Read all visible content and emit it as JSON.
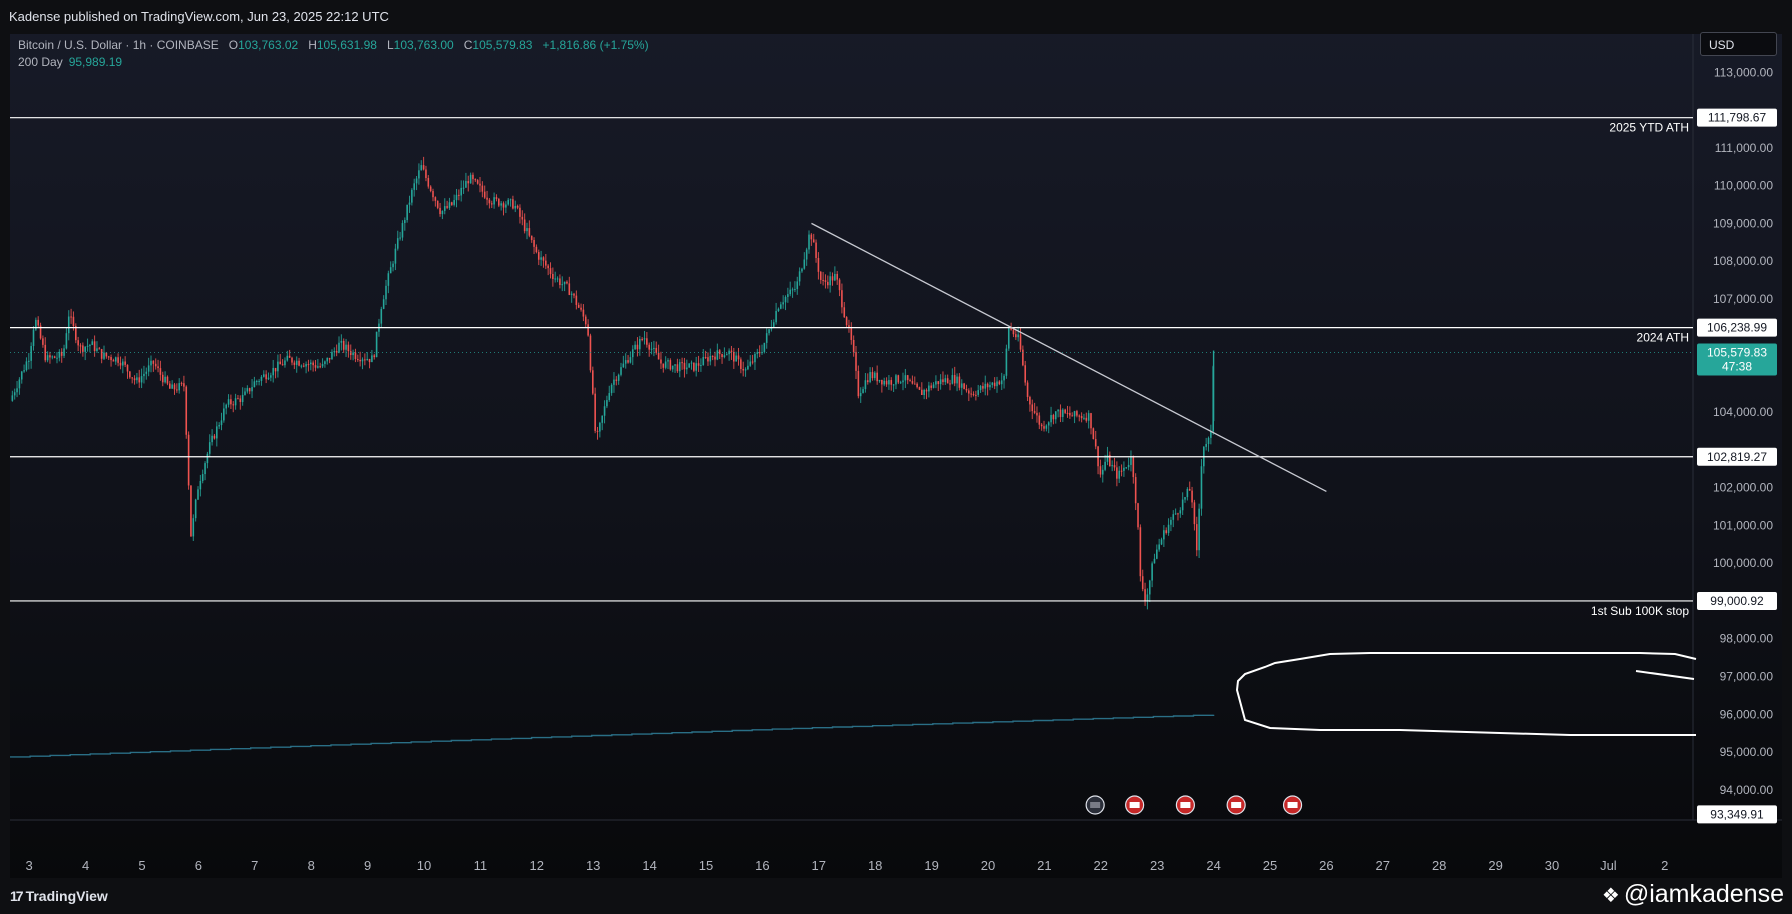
{
  "publisher": "Kadense published on TradingView.com, Jun 23, 2025 22:12 UTC",
  "legend": {
    "symbol": "Bitcoin / U.S. Dollar · 1h · COINBASE",
    "o_label": "O",
    "o": "103,763.02",
    "h_label": "H",
    "h": "105,631.98",
    "l_label": "L",
    "l": "103,763.00",
    "c_label": "C",
    "c": "105,579.83",
    "change": "+1,816.86 (+1.75%)",
    "ma_label": "200 Day",
    "ma_value": "95,989.19"
  },
  "currency": "USD",
  "branding": {
    "logo": "TradingView",
    "watermark": "@iamkadense"
  },
  "colors": {
    "up": "#26a69a",
    "down": "#ef5350",
    "ma": "#2a6f86",
    "background": "#0e0f12",
    "hline": "#ffffff"
  },
  "chart_data": {
    "type": "line",
    "timeframe": "1h",
    "ylim": [
      93200,
      114200
    ],
    "y_ticks": [
      {
        "v": 94000,
        "label": "94,000.00"
      },
      {
        "v": 95000,
        "label": "95,000.00"
      },
      {
        "v": 96000,
        "label": "96,000.00"
      },
      {
        "v": 97000,
        "label": "97,000.00"
      },
      {
        "v": 98000,
        "label": "98,000.00"
      },
      {
        "v": 100000,
        "label": "100,000.00"
      },
      {
        "v": 101000,
        "label": "101,000.00"
      },
      {
        "v": 102000,
        "label": "102,000.00"
      },
      {
        "v": 104000,
        "label": "104,000.00"
      },
      {
        "v": 107000,
        "label": "107,000.00"
      },
      {
        "v": 108000,
        "label": "108,000.00"
      },
      {
        "v": 109000,
        "label": "109,000.00"
      },
      {
        "v": 110000,
        "label": "110,000.00"
      },
      {
        "v": 111000,
        "label": "111,000.00"
      },
      {
        "v": 113000,
        "label": "113,000.00"
      }
    ],
    "x_ticks": [
      "3",
      "4",
      "5",
      "6",
      "7",
      "8",
      "9",
      "10",
      "11",
      "12",
      "13",
      "14",
      "15",
      "16",
      "17",
      "18",
      "19",
      "20",
      "21",
      "22",
      "23",
      "24",
      "25",
      "26",
      "27",
      "28",
      "29",
      "30",
      "Jul",
      "2"
    ],
    "x_tick_values": [
      3,
      4,
      5,
      6,
      7,
      8,
      9,
      10,
      11,
      12,
      13,
      14,
      15,
      16,
      17,
      18,
      19,
      20,
      21,
      22,
      23,
      24,
      25,
      26,
      27,
      28,
      29,
      30,
      31,
      32
    ],
    "xlim": [
      2.66,
      32.5
    ],
    "price_path": [
      [
        2.66,
        104300
      ],
      [
        3.0,
        105500
      ],
      [
        3.1,
        106500
      ],
      [
        3.3,
        105400
      ],
      [
        3.6,
        105500
      ],
      [
        3.7,
        106600
      ],
      [
        3.9,
        105700
      ],
      [
        4.1,
        105800
      ],
      [
        4.3,
        105500
      ],
      [
        4.6,
        105400
      ],
      [
        4.9,
        104800
      ],
      [
        5.2,
        105300
      ],
      [
        5.5,
        104600
      ],
      [
        5.75,
        104700
      ],
      [
        5.8,
        103000
      ],
      [
        5.87,
        100700
      ],
      [
        6.0,
        102100
      ],
      [
        6.2,
        103100
      ],
      [
        6.5,
        104200
      ],
      [
        6.8,
        104400
      ],
      [
        7.0,
        104800
      ],
      [
        7.3,
        105100
      ],
      [
        7.6,
        105400
      ],
      [
        7.9,
        105300
      ],
      [
        8.2,
        105200
      ],
      [
        8.5,
        105800
      ],
      [
        8.8,
        105500
      ],
      [
        9.1,
        105400
      ],
      [
        9.25,
        106900
      ],
      [
        9.5,
        108300
      ],
      [
        9.8,
        109900
      ],
      [
        9.95,
        110500
      ],
      [
        10.3,
        109300
      ],
      [
        10.5,
        109500
      ],
      [
        10.8,
        110200
      ],
      [
        11.2,
        109600
      ],
      [
        11.6,
        109500
      ],
      [
        12.0,
        108200
      ],
      [
        12.3,
        107600
      ],
      [
        12.6,
        107200
      ],
      [
        12.9,
        106300
      ],
      [
        13.05,
        103200
      ],
      [
        13.3,
        104700
      ],
      [
        13.6,
        105400
      ],
      [
        13.9,
        106000
      ],
      [
        14.2,
        105300
      ],
      [
        14.5,
        105200
      ],
      [
        14.8,
        105200
      ],
      [
        15.1,
        105500
      ],
      [
        15.4,
        105600
      ],
      [
        15.7,
        105100
      ],
      [
        16.0,
        105700
      ],
      [
        16.3,
        106900
      ],
      [
        16.6,
        107300
      ],
      [
        16.85,
        108800
      ],
      [
        17.05,
        107400
      ],
      [
        17.3,
        107600
      ],
      [
        17.6,
        105700
      ],
      [
        17.7,
        104500
      ],
      [
        17.9,
        105000
      ],
      [
        18.2,
        104800
      ],
      [
        18.5,
        104900
      ],
      [
        18.8,
        104500
      ],
      [
        19.1,
        104800
      ],
      [
        19.4,
        104900
      ],
      [
        19.7,
        104500
      ],
      [
        20.0,
        104700
      ],
      [
        20.3,
        104900
      ],
      [
        20.35,
        106300
      ],
      [
        20.55,
        105900
      ],
      [
        20.7,
        104400
      ],
      [
        20.95,
        103600
      ],
      [
        21.2,
        104000
      ],
      [
        21.5,
        103900
      ],
      [
        21.8,
        103900
      ],
      [
        22.0,
        102300
      ],
      [
        22.1,
        102800
      ],
      [
        22.3,
        102300
      ],
      [
        22.55,
        102800
      ],
      [
        22.65,
        101200
      ],
      [
        22.7,
        99600
      ],
      [
        22.8,
        99000
      ],
      [
        22.95,
        100200
      ],
      [
        23.15,
        100900
      ],
      [
        23.4,
        101500
      ],
      [
        23.6,
        102000
      ],
      [
        23.7,
        100200
      ],
      [
        23.8,
        103100
      ],
      [
        23.95,
        103300
      ],
      [
        24.0,
        105580
      ]
    ],
    "ma_200_day": [
      [
        2.66,
        94870
      ],
      [
        10.0,
        95280
      ],
      [
        17.0,
        95650
      ],
      [
        24.0,
        95989
      ]
    ],
    "horizontal_levels": [
      {
        "price": 111798.67,
        "label": "2025 YTD ATH",
        "price_label": "111,798.67"
      },
      {
        "price": 106238.99,
        "label": "2024 ATH",
        "price_label": "106,238.99"
      },
      {
        "price": 102819.27,
        "label": "",
        "price_label": "102,819.27"
      },
      {
        "price": 99000.92,
        "label": "1st Sub 100K stop",
        "price_label": "99,000.92"
      }
    ],
    "trendline": [
      [
        16.87,
        109000
      ],
      [
        26.0,
        101900
      ]
    ],
    "current_price": {
      "price": 105579.83,
      "label": "105,579.83",
      "countdown": "47:38"
    },
    "bottom_price_label": {
      "price": 93349.91,
      "label": "93,349.91"
    },
    "event_markers": [
      21.9,
      22.6,
      23.5,
      24.4,
      25.4
    ],
    "event_icon_names": [
      "flash-icon",
      "us-flag-icon",
      "us-flag-icon",
      "us-flag-icon",
      "us-flag-icon"
    ]
  }
}
